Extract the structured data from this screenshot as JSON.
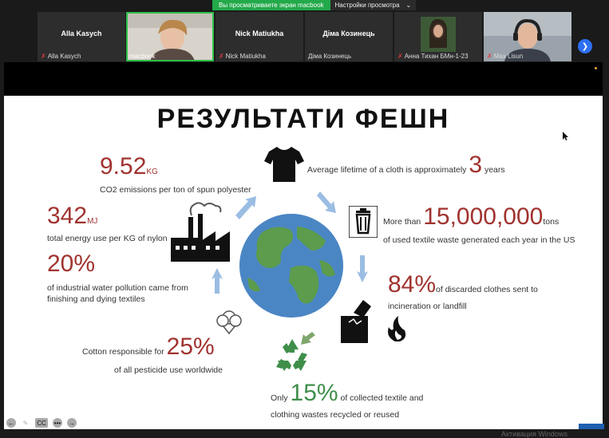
{
  "banner": {
    "share_message": "Вы просматриваете экран macbook",
    "view_options": "Настройки просмотра"
  },
  "participants": [
    {
      "name": "Alla Kasych",
      "caption": "Alla Kasych",
      "muted": true
    },
    {
      "name": "",
      "caption": "macbook",
      "muted": false,
      "active": true
    },
    {
      "name": "Nick Matiukha",
      "caption": "Nick Matiukha",
      "muted": true
    },
    {
      "name": "Діма Козинець",
      "caption": "Діма Козинець",
      "muted": false
    },
    {
      "name": "",
      "caption": "Анна Тихан БМн-1-23",
      "muted": true
    },
    {
      "name": "",
      "caption": "Max Lisun",
      "muted": true
    }
  ],
  "slide": {
    "title": "РЕЗУЛЬТАТИ ФЕШН",
    "stats": {
      "co2": {
        "value": "9.52",
        "unit": "KG",
        "text": "CO2 emissions per ton of spun polyester"
      },
      "lifetime": {
        "prefix": "Average lifetime of a cloth is approximately",
        "value": "3",
        "suffix": "years"
      },
      "energy": {
        "value": "342",
        "unit": "MJ",
        "text": "total energy use per KG of nylon"
      },
      "waste": {
        "prefix": "More than",
        "value": "15,000,000",
        "unit": "tons",
        "text": "of used textile waste generated each year in the US"
      },
      "water": {
        "value": "20%",
        "text": "of industrial water pollution came from finishing and dying textiles"
      },
      "discarded": {
        "value": "84%",
        "text1": "of discarded clothes sent to",
        "text2": "incineration or landfill"
      },
      "cotton": {
        "prefix": "Cotton responsible for",
        "value": "25%",
        "text": "of all pesticide use worldwide"
      },
      "recycled": {
        "prefix": "Only",
        "value": "15%",
        "text1": "of collected textile and",
        "text2": "clothing wastes recycled or reused"
      }
    }
  },
  "footer": {
    "activate_windows": "Активация Windows"
  },
  "colors": {
    "accent_red": "#a0332f",
    "share_green": "#23a94a",
    "recycle_green": "#3f8f4a"
  }
}
